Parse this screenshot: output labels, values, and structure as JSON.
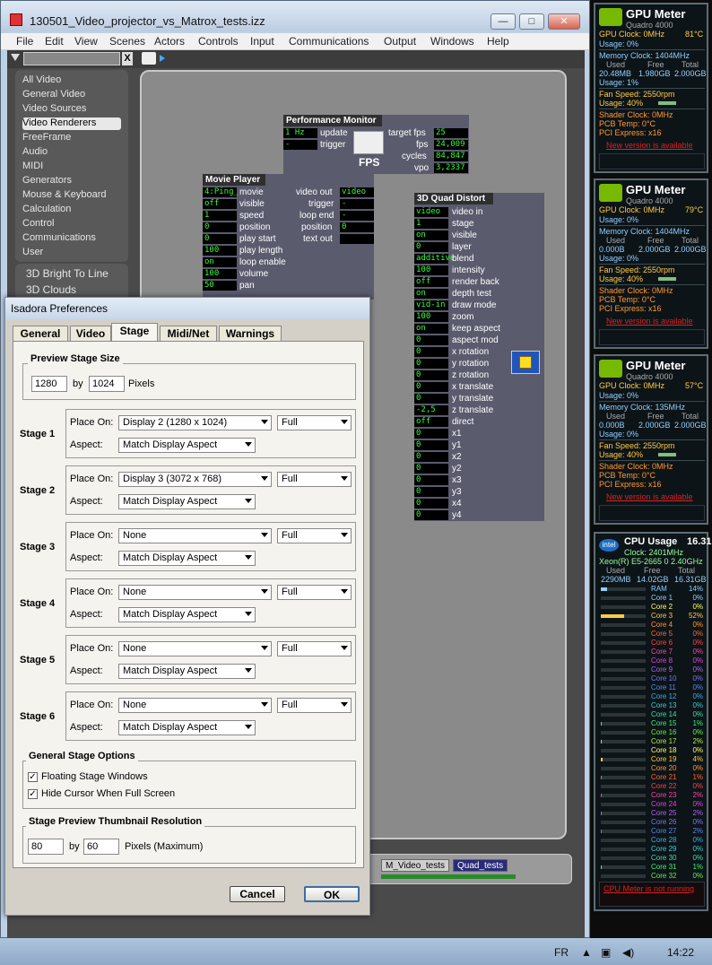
{
  "window": {
    "title": "130501_Video_projector_vs_Matrox_tests.izz",
    "min": "—",
    "max": "□",
    "close": "✕"
  },
  "menu": [
    "File",
    "Edit",
    "View",
    "Scenes",
    "Actors",
    "Controls",
    "Input",
    "Communications",
    "Output",
    "Windows",
    "Help"
  ],
  "toolbar": {
    "search_clear": "X"
  },
  "categories": [
    {
      "label": "All Video",
      "selected": false
    },
    {
      "label": "General Video",
      "selected": false
    },
    {
      "label": "Video Sources",
      "selected": false
    },
    {
      "label": "Video Renderers",
      "selected": true
    },
    {
      "label": "FreeFrame",
      "selected": false
    },
    {
      "label": "Audio",
      "selected": false
    },
    {
      "label": "MIDI",
      "selected": false
    },
    {
      "label": "Generators",
      "selected": false
    },
    {
      "label": "Mouse & Keyboard",
      "selected": false
    },
    {
      "label": "Calculation",
      "selected": false
    },
    {
      "label": "Control",
      "selected": false
    },
    {
      "label": "Communications",
      "selected": false
    },
    {
      "label": "User",
      "selected": false
    }
  ],
  "actors": [
    "3D Bright To Line",
    "3D Clouds"
  ],
  "perf_monitor": {
    "title": "Performance Monitor",
    "inputs": [
      {
        "val": "1 Hz",
        "label": "update"
      },
      {
        "val": "-",
        "label": "trigger"
      }
    ],
    "outputs": [
      {
        "label": "target fps",
        "val": "25"
      },
      {
        "label": "fps",
        "val": "24,009"
      },
      {
        "label": "cycles",
        "val": "84,847"
      },
      {
        "label": "vpo",
        "val": "3,2337"
      }
    ],
    "icon_label": "FPS"
  },
  "movie_player": {
    "title": "Movie Player",
    "inputs": [
      {
        "val": "4:Ping_",
        "label": "movie"
      },
      {
        "val": "off",
        "label": "visible"
      },
      {
        "val": "1",
        "label": "speed"
      },
      {
        "val": "0",
        "label": "position"
      },
      {
        "val": "0",
        "label": "play start"
      },
      {
        "val": "100",
        "label": "play length"
      },
      {
        "val": "on",
        "label": "loop enable"
      },
      {
        "val": "100",
        "label": "volume"
      },
      {
        "val": "50",
        "label": "pan"
      }
    ],
    "outputs": [
      {
        "label": "video out",
        "val": "video"
      },
      {
        "label": "trigger",
        "val": "-"
      },
      {
        "label": "loop end",
        "val": "-"
      },
      {
        "label": "position",
        "val": "0"
      },
      {
        "label": "text out",
        "val": ""
      }
    ]
  },
  "quad_distort": {
    "title": "3D Quad Distort",
    "inputs": [
      {
        "val": "video",
        "label": "video in"
      },
      {
        "val": "1",
        "label": "stage"
      },
      {
        "val": "on",
        "label": "visible"
      },
      {
        "val": "0",
        "label": "layer"
      },
      {
        "val": "additive",
        "label": "blend"
      },
      {
        "val": "100",
        "label": "intensity"
      },
      {
        "val": "off",
        "label": "render back"
      },
      {
        "val": "on",
        "label": "depth test"
      },
      {
        "val": "vid-in",
        "label": "draw mode"
      },
      {
        "val": "100",
        "label": "zoom"
      },
      {
        "val": "on",
        "label": "keep aspect"
      },
      {
        "val": "0",
        "label": "aspect mod"
      },
      {
        "val": "0",
        "label": "x rotation"
      },
      {
        "val": "0",
        "label": "y rotation"
      },
      {
        "val": "0",
        "label": "z rotation"
      },
      {
        "val": "0",
        "label": "x translate"
      },
      {
        "val": "0",
        "label": "y translate"
      },
      {
        "val": "-2,5",
        "label": "z translate"
      },
      {
        "val": "off",
        "label": "direct"
      },
      {
        "val": "0",
        "label": "x1"
      },
      {
        "val": "0",
        "label": "y1"
      },
      {
        "val": "0",
        "label": "x2"
      },
      {
        "val": "0",
        "label": "y2"
      },
      {
        "val": "0",
        "label": "x3"
      },
      {
        "val": "0",
        "label": "y3"
      },
      {
        "val": "0",
        "label": "x4"
      },
      {
        "val": "0",
        "label": "y4"
      }
    ]
  },
  "scenes": [
    "M_Video_tests",
    "Quad_tests"
  ],
  "dialog": {
    "title": "Isadora Preferences",
    "tabs": [
      "General",
      "Video",
      "Stage",
      "Midi/Net",
      "Warnings"
    ],
    "active_tab": "Stage",
    "preview": {
      "title": "Preview Stage Size",
      "width": "1280",
      "by": "by",
      "height": "1024",
      "unit": "Pixels"
    },
    "place_label": "Place On:",
    "aspect_label": "Aspect:",
    "stages": [
      {
        "label": "Stage 1",
        "place": "Display 2 (1280 x 1024)",
        "mode": "Full",
        "aspect": "Match Display Aspect"
      },
      {
        "label": "Stage 2",
        "place": "Display 3 (3072 x 768)",
        "mode": "Full",
        "aspect": "Match Display Aspect"
      },
      {
        "label": "Stage 3",
        "place": "None",
        "mode": "Full",
        "aspect": "Match Display Aspect"
      },
      {
        "label": "Stage 4",
        "place": "None",
        "mode": "Full",
        "aspect": "Match Display Aspect"
      },
      {
        "label": "Stage 5",
        "place": "None",
        "mode": "Full",
        "aspect": "Match Display Aspect"
      },
      {
        "label": "Stage 6",
        "place": "None",
        "mode": "Full",
        "aspect": "Match Display Aspect"
      }
    ],
    "general_options": {
      "title": "General Stage Options",
      "floating": {
        "label": "Floating Stage Windows",
        "checked": true
      },
      "hide_cursor": {
        "label": "Hide Cursor When Full Screen",
        "checked": true
      }
    },
    "thumb": {
      "title": "Stage Preview Thumbnail Resolution",
      "width": "80",
      "by": "by",
      "height": "60",
      "unit": "Pixels (Maximum)"
    },
    "cancel": "Cancel",
    "ok": "OK"
  },
  "gpus": [
    {
      "title": "GPU Meter",
      "model": "Quadro 4000",
      "clock": "GPU Clock: 0MHz",
      "temp": "81°C",
      "usage": "Usage: 0%",
      "mem_clock": "Memory Clock: 1404MHz",
      "used_h": "Used",
      "free_h": "Free",
      "total_h": "Total",
      "used": "20.48MB",
      "free": "1.980GB",
      "total": "2.000GB",
      "mem_usage": "Usage: 1%",
      "fan": "Fan Speed: 2550rpm",
      "fan_usage": "Usage: 40%",
      "shader": "Shader Clock: 0MHz",
      "pcb": "PCB Temp: 0°C",
      "pci": "PCI Express: x16",
      "notice": "New version is available",
      "fan_level": 0.4
    },
    {
      "title": "GPU Meter",
      "model": "Quadro 4000",
      "clock": "GPU Clock: 0MHz",
      "temp": "79°C",
      "usage": "Usage: 0%",
      "mem_clock": "Memory Clock: 1404MHz",
      "used_h": "Used",
      "free_h": "Free",
      "total_h": "Total",
      "used": "0.000B",
      "free": "2.000GB",
      "total": "2.000GB",
      "mem_usage": "Usage: 0%",
      "fan": "Fan Speed: 2550rpm",
      "fan_usage": "Usage: 40%",
      "shader": "Shader Clock: 0MHz",
      "pcb": "PCB Temp: 0°C",
      "pci": "PCI Express: x16",
      "notice": "New version is available",
      "fan_level": 0.4
    },
    {
      "title": "GPU Meter",
      "model": "Quadro 4000",
      "clock": "GPU Clock: 0MHz",
      "temp": "57°C",
      "usage": "Usage: 0%",
      "mem_clock": "Memory Clock: 135MHz",
      "used_h": "Used",
      "free_h": "Free",
      "total_h": "Total",
      "used": "0.000B",
      "free": "2.000GB",
      "total": "2.000GB",
      "mem_usage": "Usage: 0%",
      "fan": "Fan Speed: 2550rpm",
      "fan_usage": "Usage: 40%",
      "shader": "Shader Clock: 0MHz",
      "pcb": "PCB Temp: 0°C",
      "pci": "PCI Express: x16",
      "notice": "New version is available",
      "fan_level": 0.4
    }
  ],
  "cpu": {
    "title": "CPU Usage",
    "total": "16.31GB",
    "clock": "Clock: 2401MHz",
    "model": "Xeon(R) E5-2665 0 2.40GHz",
    "used_h": "Used",
    "free_h": "Free",
    "total_h": "Total",
    "used": "2290MB",
    "free": "14.02GB",
    "ram_label": "RAM",
    "ram": "14%",
    "notice": "CPU Meter is not running",
    "cores": [
      {
        "name": "Core 1",
        "val": "0%",
        "color": "#8fd0ff"
      },
      {
        "name": "Core 2",
        "val": "0%",
        "color": "#ffff66"
      },
      {
        "name": "Core 3",
        "val": "52%",
        "color": "#ffcc44"
      },
      {
        "name": "Core 4",
        "val": "0%",
        "color": "#ff9933"
      },
      {
        "name": "Core 5",
        "val": "0%",
        "color": "#ff6633"
      },
      {
        "name": "Core 6",
        "val": "0%",
        "color": "#ff4444"
      },
      {
        "name": "Core 7",
        "val": "0%",
        "color": "#ff44aa"
      },
      {
        "name": "Core 8",
        "val": "0%",
        "color": "#dd44dd"
      },
      {
        "name": "Core 9",
        "val": "0%",
        "color": "#aa66ee"
      },
      {
        "name": "Core 10",
        "val": "0%",
        "color": "#7777ee"
      },
      {
        "name": "Core 11",
        "val": "0%",
        "color": "#5588ee"
      },
      {
        "name": "Core 12",
        "val": "0%",
        "color": "#44aadd"
      },
      {
        "name": "Core 13",
        "val": "0%",
        "color": "#44cccc"
      },
      {
        "name": "Core 14",
        "val": "0%",
        "color": "#44ddaa"
      },
      {
        "name": "Core 15",
        "val": "1%",
        "color": "#44ee77"
      },
      {
        "name": "Core 16",
        "val": "0%",
        "color": "#66ee44"
      },
      {
        "name": "Core 17",
        "val": "2%",
        "color": "#aaee44"
      },
      {
        "name": "Core 18",
        "val": "0%",
        "color": "#ffff66"
      },
      {
        "name": "Core 19",
        "val": "4%",
        "color": "#ffcc44"
      },
      {
        "name": "Core 20",
        "val": "0%",
        "color": "#ff9933"
      },
      {
        "name": "Core 21",
        "val": "1%",
        "color": "#ff6633"
      },
      {
        "name": "Core 22",
        "val": "0%",
        "color": "#ff4444"
      },
      {
        "name": "Core 23",
        "val": "2%",
        "color": "#ff44aa"
      },
      {
        "name": "Core 24",
        "val": "0%",
        "color": "#dd44dd"
      },
      {
        "name": "Core 25",
        "val": "2%",
        "color": "#aa66ee"
      },
      {
        "name": "Core 26",
        "val": "0%",
        "color": "#7777ee"
      },
      {
        "name": "Core 27",
        "val": "2%",
        "color": "#5588ee"
      },
      {
        "name": "Core 28",
        "val": "0%",
        "color": "#44aadd"
      },
      {
        "name": "Core 29",
        "val": "0%",
        "color": "#44cccc"
      },
      {
        "name": "Core 30",
        "val": "0%",
        "color": "#44ddaa"
      },
      {
        "name": "Core 31",
        "val": "1%",
        "color": "#44ee77"
      },
      {
        "name": "Core 32",
        "val": "0%",
        "color": "#66ee44"
      }
    ]
  },
  "taskbar": {
    "lang": "FR",
    "time": "14:22"
  }
}
